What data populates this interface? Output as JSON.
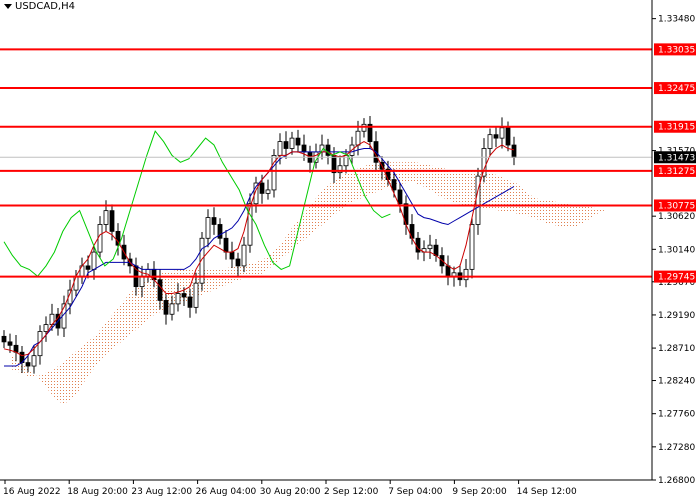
{
  "window": {
    "symbol_title": "USDCAD,H4"
  },
  "colors": {
    "background": "#ffffff",
    "level_line": "#ff0000",
    "level_label_bg": "#ff0000",
    "level_label_text": "#ffffff",
    "price_label_bg": "#000000",
    "tenkan": "#cc0000",
    "kijun": "#0000aa",
    "chikou": "#00cc00",
    "cloud": "#e08050",
    "candle": "#000000"
  },
  "chart_data": {
    "type": "line",
    "ylim": [
      1.268,
      1.3375
    ],
    "price_ticks": [
      "1.33480",
      "1.31570",
      "1.30620",
      "1.30140",
      "1.29670",
      "1.29190",
      "1.28710",
      "1.28240",
      "1.27760",
      "1.27280",
      "1.26800"
    ],
    "time_ticks": [
      "16 Aug 2022",
      "18 Aug 20:00",
      "23 Aug 12:00",
      "26 Aug 04:00",
      "30 Aug 20:00",
      "2 Sep 12:00",
      "7 Sep 04:00",
      "9 Sep 20:00",
      "14 Sep 12:00"
    ],
    "levels": [
      {
        "value": 1.33035,
        "label": "1.33035"
      },
      {
        "value": 1.32475,
        "label": "1.32475"
      },
      {
        "value": 1.31915,
        "label": "1.31915"
      },
      {
        "value": 1.31275,
        "label": "1.31275"
      },
      {
        "value": 1.30775,
        "label": "1.30775"
      },
      {
        "value": 1.29745,
        "label": "1.29745"
      }
    ],
    "current_price": {
      "value": 1.31473,
      "label": "1.31473"
    },
    "close": [
      1.288,
      1.2875,
      1.2865,
      1.285,
      1.2845,
      1.286,
      1.2895,
      1.2905,
      1.292,
      1.29,
      1.2935,
      1.2955,
      1.2975,
      1.299,
      1.2985,
      1.301,
      1.305,
      1.307,
      1.304,
      1.302,
      1.3,
      1.299,
      1.296,
      1.2975,
      1.2985,
      1.297,
      1.294,
      1.292,
      1.2935,
      1.295,
      1.2945,
      1.293,
      1.2965,
      1.303,
      1.306,
      1.305,
      1.303,
      1.301,
      1.3,
      1.299,
      1.302,
      1.308,
      1.311,
      1.3095,
      1.31,
      1.315,
      1.317,
      1.316,
      1.3175,
      1.3165,
      1.3155,
      1.314,
      1.3155,
      1.3165,
      1.315,
      1.3125,
      1.3135,
      1.315,
      1.3165,
      1.3185,
      1.3195,
      1.317,
      1.314,
      1.313,
      1.3115,
      1.31,
      1.308,
      1.305,
      1.303,
      1.301,
      1.3015,
      1.302,
      1.3005,
      1.299,
      1.2975,
      1.298,
      1.297,
      1.2985,
      1.305,
      1.312,
      1.316,
      1.318,
      1.3175,
      1.319,
      1.3165,
      1.3147
    ],
    "tenkan": [
      1.287,
      1.2868,
      1.2865,
      1.286,
      1.2862,
      1.287,
      1.288,
      1.289,
      1.2905,
      1.2915,
      1.293,
      1.295,
      1.2975,
      1.299,
      1.3,
      1.302,
      1.3035,
      1.304,
      1.3035,
      1.3025,
      1.301,
      1.2995,
      1.2985,
      1.298,
      1.2978,
      1.297,
      1.296,
      1.295,
      1.295,
      1.2952,
      1.2955,
      1.296,
      1.2985,
      1.3,
      1.301,
      1.302,
      1.3015,
      1.301,
      1.301,
      1.3015,
      1.304,
      1.3075,
      1.31,
      1.3115,
      1.3125,
      1.314,
      1.315,
      1.315,
      1.3155,
      1.3155,
      1.3152,
      1.3148,
      1.315,
      1.3155,
      1.3155,
      1.315,
      1.3148,
      1.315,
      1.3158,
      1.3165,
      1.317,
      1.3165,
      1.315,
      1.3135,
      1.3115,
      1.3095,
      1.3075,
      1.305,
      1.303,
      1.3015,
      1.301,
      1.301,
      1.3005,
      1.2998,
      1.299,
      1.2985,
      1.299,
      1.302,
      1.306,
      1.31,
      1.313,
      1.315,
      1.316,
      1.3165,
      1.316,
      1.3158
    ],
    "kijun": [
      1.2845,
      1.2845,
      1.2845,
      1.285,
      1.286,
      1.2875,
      1.288,
      1.289,
      1.29,
      1.291,
      1.292,
      1.293,
      1.2945,
      1.296,
      1.298,
      1.2985,
      1.299,
      1.2995,
      1.2995,
      1.2995,
      1.2995,
      1.2995,
      1.299,
      1.2985,
      1.2985,
      1.2985,
      1.2985,
      1.2985,
      1.2985,
      1.2985,
      1.2985,
      1.299,
      1.3,
      1.3015,
      1.302,
      1.303,
      1.3035,
      1.304,
      1.3045,
      1.3055,
      1.307,
      1.309,
      1.3105,
      1.3115,
      1.3125,
      1.3135,
      1.3145,
      1.315,
      1.3155,
      1.3155,
      1.3155,
      1.3155,
      1.3155,
      1.3155,
      1.3155,
      1.3155,
      1.3155,
      1.3155,
      1.3155,
      1.3158,
      1.316,
      1.316,
      1.3155,
      1.3145,
      1.3135,
      1.3125,
      1.311,
      1.3095,
      1.308,
      1.3065,
      1.306,
      1.3058,
      1.3055,
      1.3052,
      1.305,
      1.3055,
      1.306,
      1.3065,
      1.307,
      1.3075,
      1.308,
      1.3085,
      1.309,
      1.3095,
      1.31,
      1.3105
    ],
    "chikou": [
      1.3025,
      1.3005,
      1.299,
      1.2985,
      1.2975,
      1.299,
      1.301,
      1.304,
      1.306,
      1.307,
      1.304,
      1.301,
      1.299,
      1.3,
      1.303,
      1.307,
      1.311,
      1.315,
      1.3185,
      1.317,
      1.315,
      1.314,
      1.3145,
      1.316,
      1.3175,
      1.3165,
      1.314,
      1.312,
      1.31,
      1.307,
      1.305,
      1.302,
      1.2995,
      1.2985,
      1.299,
      1.304,
      1.309,
      1.314,
      1.316,
      1.315,
      1.3155,
      1.315,
      1.312,
      1.309,
      1.307,
      1.306,
      1.3065
    ],
    "cloud_top": [
      1.284,
      1.2835,
      1.283,
      1.283,
      1.2835,
      1.284,
      1.285,
      1.286,
      1.287,
      1.288,
      1.289,
      1.2905,
      1.292,
      1.2935,
      1.295,
      1.296,
      1.297,
      1.2975,
      1.298,
      1.2982,
      1.2985,
      1.2985,
      1.2985,
      1.2985,
      1.2985,
      1.2985,
      1.2988,
      1.299,
      1.2992,
      1.2995,
      1.3,
      1.301,
      1.302,
      1.304,
      1.3055,
      1.307,
      1.3085,
      1.31,
      1.311,
      1.312,
      1.3125,
      1.313,
      1.3135,
      1.3138,
      1.314,
      1.314,
      1.314,
      1.314,
      1.314,
      1.3138,
      1.3135,
      1.3132,
      1.313,
      1.3128,
      1.3128,
      1.3128,
      1.3126,
      1.3125,
      1.312,
      1.3115,
      1.311,
      1.31,
      1.309,
      1.3085,
      1.3085,
      1.3082,
      1.308,
      1.3078,
      1.3078,
      1.3075,
      1.3072,
      1.3072
    ],
    "cloud_bottom": [
      1.286,
      1.285,
      1.284,
      1.283,
      1.2815,
      1.28,
      1.279,
      1.2795,
      1.281,
      1.283,
      1.2845,
      1.286,
      1.287,
      1.288,
      1.289,
      1.29,
      1.291,
      1.292,
      1.2925,
      1.293,
      1.2935,
      1.294,
      1.2945,
      1.295,
      1.2955,
      1.296,
      1.2965,
      1.297,
      1.2972,
      1.2975,
      1.298,
      1.299,
      1.3,
      1.301,
      1.302,
      1.303,
      1.304,
      1.305,
      1.306,
      1.307,
      1.308,
      1.3085,
      1.309,
      1.3095,
      1.31,
      1.3105,
      1.3108,
      1.311,
      1.311,
      1.3105,
      1.3098,
      1.309,
      1.3085,
      1.308,
      1.3078,
      1.3076,
      1.3074,
      1.3072,
      1.307,
      1.3068,
      1.3066,
      1.3064,
      1.306,
      1.3055,
      1.305,
      1.3048,
      1.3045,
      1.3046,
      1.3052,
      1.306,
      1.3068,
      1.3072
    ]
  }
}
